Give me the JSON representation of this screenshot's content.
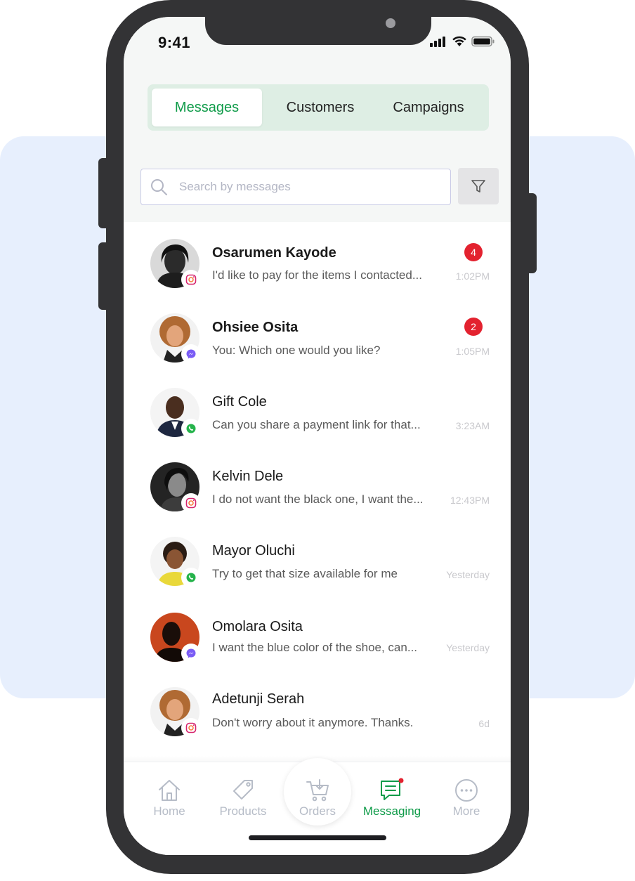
{
  "status_bar": {
    "time": "9:41"
  },
  "tabs": [
    {
      "label": "Messages",
      "active": true
    },
    {
      "label": "Customers",
      "active": false
    },
    {
      "label": "Campaigns",
      "active": false
    }
  ],
  "search": {
    "placeholder": "Search by messages",
    "value": ""
  },
  "conversations": [
    {
      "name": "Osarumen Kayode",
      "preview": "I'd like to pay for the items I contacted...",
      "time": "1:02PM",
      "unread": "4",
      "channel": "instagram-icon"
    },
    {
      "name": "Ohsiee Osita",
      "preview": "You: Which one would you like?",
      "time": "1:05PM",
      "unread": "2",
      "channel": "messenger-icon"
    },
    {
      "name": "Gift Cole",
      "preview": "Can you share a payment link for that...",
      "time": "3:23AM",
      "unread": "",
      "channel": "whatsapp-icon"
    },
    {
      "name": "Kelvin Dele",
      "preview": "I do not want the black one, I want the...",
      "time": "12:43PM",
      "unread": "",
      "channel": "instagram-icon"
    },
    {
      "name": "Mayor Oluchi",
      "preview": "Try to get that size available for me",
      "time": "Yesterday",
      "unread": "",
      "channel": "whatsapp-icon"
    },
    {
      "name": "Omolara Osita",
      "preview": "I want the blue color of the shoe, can...",
      "time": "Yesterday",
      "unread": "",
      "channel": "messenger-icon"
    },
    {
      "name": "Adetunji Serah",
      "preview": "Don't worry about it anymore. Thanks.",
      "time": "6d",
      "unread": "",
      "channel": "instagram-icon"
    }
  ],
  "nav": [
    {
      "label": "Home",
      "icon": "home-icon",
      "active": false
    },
    {
      "label": "Products",
      "icon": "tag-icon",
      "active": false
    },
    {
      "label": "Orders",
      "icon": "cart-icon",
      "active": false
    },
    {
      "label": "Messaging",
      "icon": "message-icon",
      "active": true
    },
    {
      "label": "More",
      "icon": "more-icon",
      "active": false
    }
  ],
  "colors": {
    "accent_green": "#0f9b49",
    "tab_bg": "#deeee4",
    "unread_red": "#e3222f",
    "background_card": "#e7effd",
    "phone_frame": "#333335"
  }
}
